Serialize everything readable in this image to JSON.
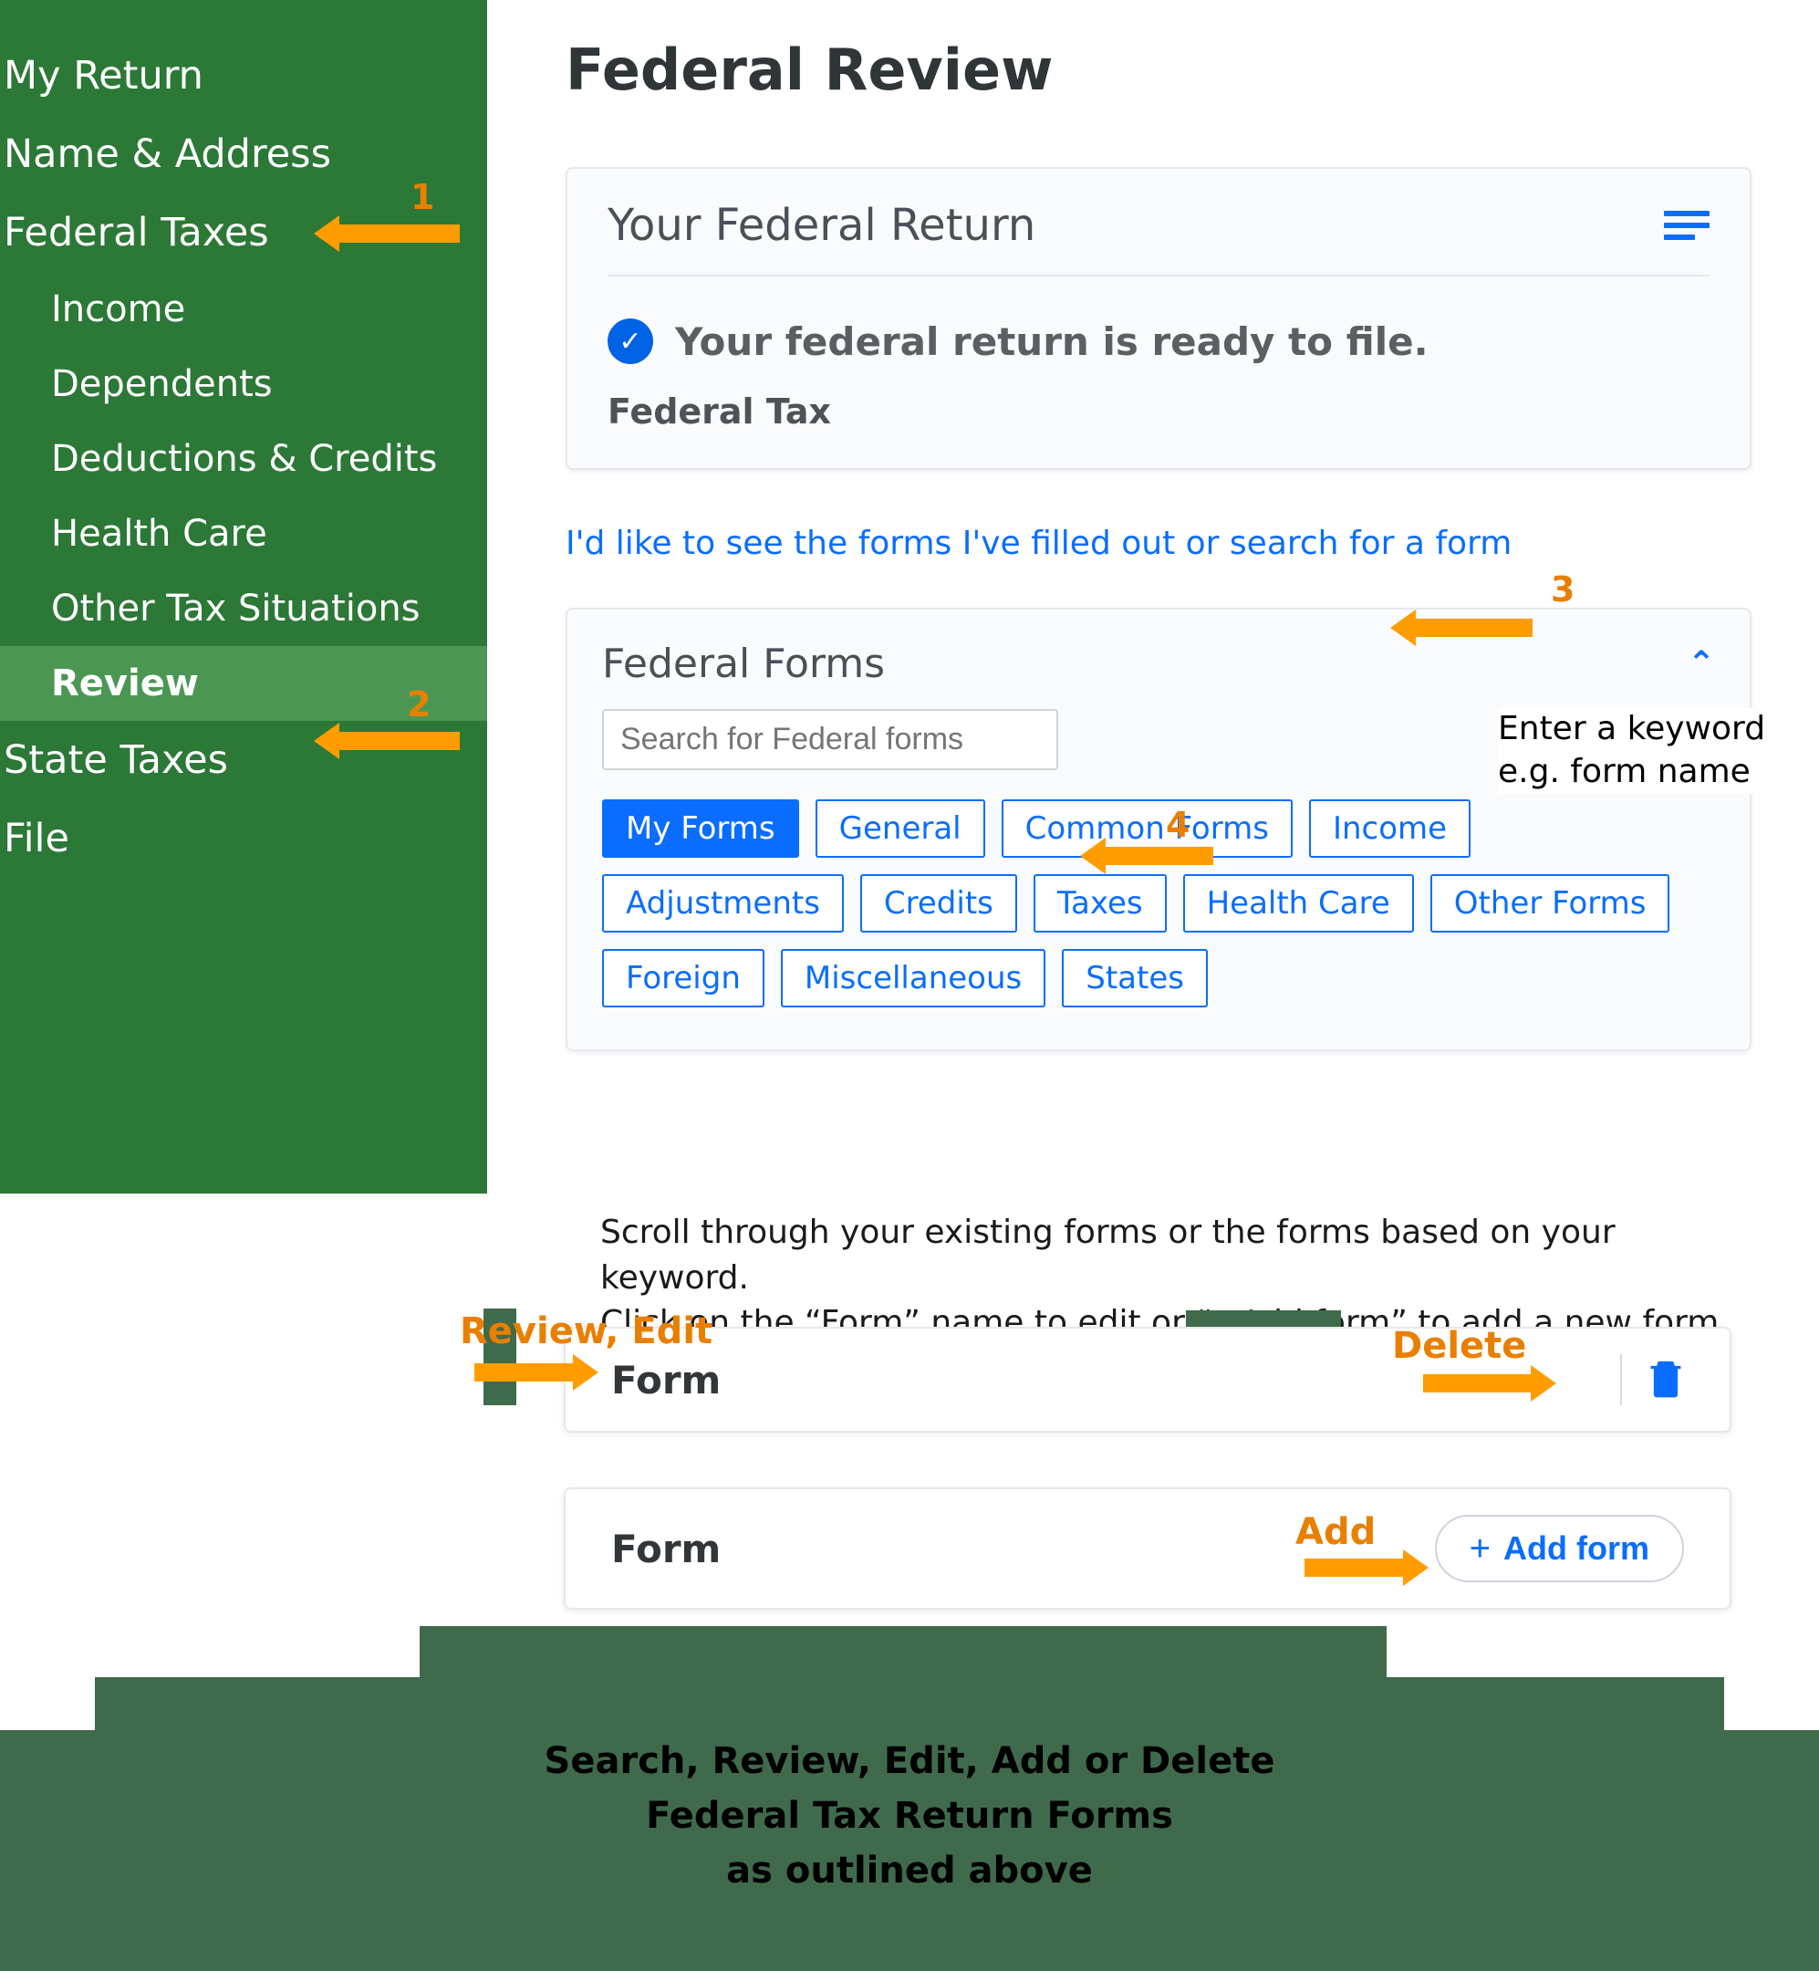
{
  "sidebar": {
    "items": [
      {
        "label": "My Return",
        "level": "top"
      },
      {
        "label": "Name & Address",
        "level": "top"
      },
      {
        "label": "Federal Taxes",
        "level": "top"
      },
      {
        "label": "Income",
        "level": "sub"
      },
      {
        "label": "Dependents",
        "level": "sub"
      },
      {
        "label": "Deductions & Credits",
        "level": "sub"
      },
      {
        "label": "Health Care",
        "level": "sub"
      },
      {
        "label": "Other Tax Situations",
        "level": "sub"
      },
      {
        "label": "Review",
        "level": "sub",
        "active": true
      },
      {
        "label": "State Taxes",
        "level": "top"
      },
      {
        "label": "File",
        "level": "top"
      }
    ]
  },
  "page": {
    "title": "Federal Review"
  },
  "return_card": {
    "title": "Your Federal Return",
    "status": "Your federal return is ready to file.",
    "tax_label": "Federal Tax"
  },
  "forms_link": "I'd like to see the forms I've filled out or search for a form",
  "forms_card": {
    "title": "Federal Forms",
    "search_placeholder": "Search for Federal forms",
    "chips": [
      "My Forms",
      "General",
      "Common Forms",
      "Income",
      "Adjustments",
      "Credits",
      "Taxes",
      "Health Care",
      "Other Forms",
      "Foreign",
      "Miscellaneous",
      "States"
    ],
    "active_chip": "My Forms"
  },
  "instruction": {
    "line1": "Scroll through your existing forms or the forms based on your keyword.",
    "line2": "Click on the “Form” name to edit or “+Add form” to add a new form."
  },
  "form_rows": {
    "row1_label": "Form",
    "row2_label": "Form",
    "add_button": "Add form"
  },
  "annotations": {
    "n1": "1",
    "n2": "2",
    "n3": "3",
    "n4": "4",
    "hint": "Enter a keyword e.g. form name",
    "review_edit": "Review, Edit",
    "delete": "Delete",
    "add": "Add"
  },
  "banner": {
    "line1": "Search, Review, Edit, Add or Delete",
    "line2": "Federal Tax Return Forms",
    "line3": "as outlined above"
  }
}
